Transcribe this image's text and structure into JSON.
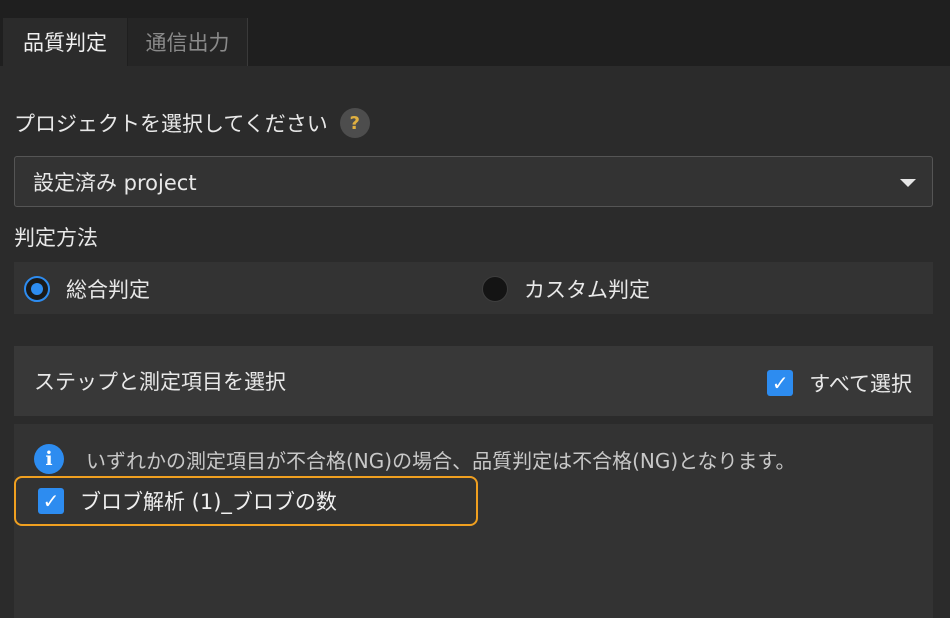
{
  "tabs": [
    {
      "label": "品質判定",
      "active": true
    },
    {
      "label": "通信出力",
      "active": false
    }
  ],
  "project": {
    "label": "プロジェクトを選択してください",
    "help_icon": "?",
    "selected": "設定済み project"
  },
  "method": {
    "label": "判定方法",
    "options": [
      {
        "label": "総合判定",
        "selected": true
      },
      {
        "label": "カスタム判定",
        "selected": false
      }
    ]
  },
  "steps": {
    "title": "ステップと測定項目を選択",
    "select_all_label": "すべて選択",
    "select_all_checked": true,
    "info_icon": "i",
    "info_text": "いずれかの測定項目が不合格(NG)の場合、品質判定は不合格(NG)となります。",
    "items": [
      {
        "label": "ブロブ解析 (1)_ブロブの数",
        "checked": true
      }
    ]
  },
  "colors": {
    "accent": "#2d8cf0",
    "highlight": "#f0a020"
  },
  "icons": {
    "check": "✓"
  }
}
